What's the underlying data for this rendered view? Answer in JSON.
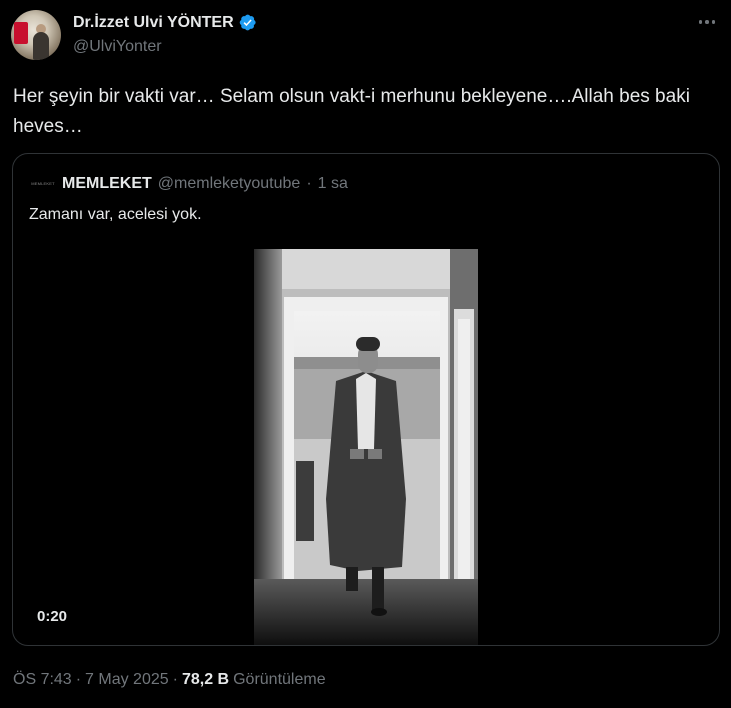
{
  "author": {
    "display_name": "Dr.İzzet Ulvi YÖNTER",
    "handle": "@UlviYonter",
    "verified": true
  },
  "tweet": {
    "text": "Her şeyin bir vakti var… Selam olsun vakt-i merhunu bekleyene….Allah bes baki heves…"
  },
  "quoted_tweet": {
    "logo_text": "MEMLEKET",
    "display_name": "MEMLEKET",
    "handle": "@memleketyoutube",
    "separator": "·",
    "time": "1 sa",
    "text": "Zamanı var, acelesi yok.",
    "video": {
      "duration": "0:20"
    }
  },
  "meta": {
    "time": "ÖS 7:43",
    "sep1": "·",
    "date": "7 May 2025",
    "sep2": "·",
    "views": "78,2 B",
    "views_label": "Görüntüleme"
  },
  "icons": {
    "verified": "verified-badge-icon",
    "more": "more-options-icon"
  },
  "colors": {
    "background": "#000000",
    "text": "#e7e9ea",
    "secondary": "#71767b",
    "border": "#2f3336",
    "verified": "#1d9bf0"
  }
}
